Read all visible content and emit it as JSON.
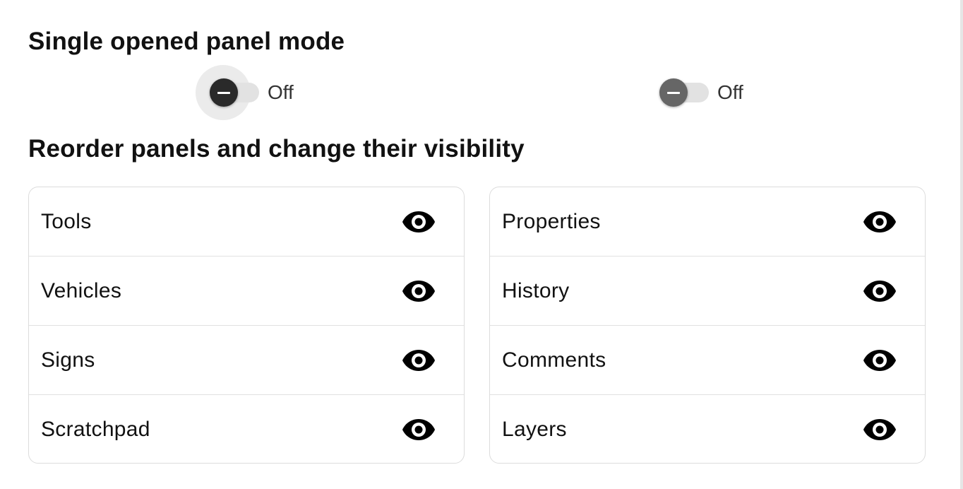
{
  "sections": {
    "single_mode_title": "Single opened panel mode",
    "reorder_title": "Reorder panels and change their visibility"
  },
  "toggles": [
    {
      "label": "Off",
      "state": "off",
      "focused": true
    },
    {
      "label": "Off",
      "state": "off",
      "focused": false
    }
  ],
  "panels": {
    "left": [
      {
        "name": "Tools",
        "visible": true,
        "icon": "eye-icon"
      },
      {
        "name": "Vehicles",
        "visible": true,
        "icon": "eye-icon"
      },
      {
        "name": "Signs",
        "visible": true,
        "icon": "eye-icon"
      },
      {
        "name": "Scratchpad",
        "visible": true,
        "icon": "eye-icon"
      }
    ],
    "right": [
      {
        "name": "Properties",
        "visible": true,
        "icon": "eye-icon"
      },
      {
        "name": "History",
        "visible": true,
        "icon": "eye-icon"
      },
      {
        "name": "Comments",
        "visible": true,
        "icon": "eye-icon"
      },
      {
        "name": "Layers",
        "visible": true,
        "icon": "eye-icon"
      }
    ]
  },
  "colors": {
    "toggle_thumb_focused": "#2a2a2a",
    "toggle_thumb": "#666666",
    "toggle_track": "#e2e2e2",
    "border": "#dcdcdc"
  }
}
